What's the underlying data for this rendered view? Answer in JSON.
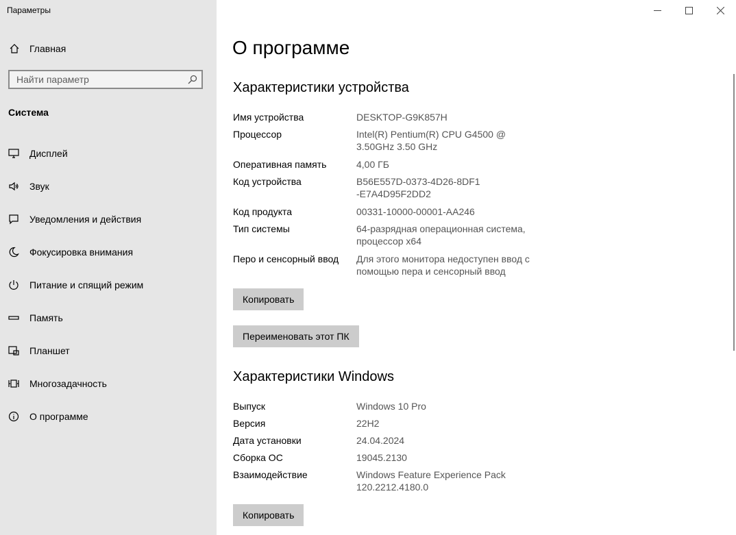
{
  "window": {
    "title": "Параметры"
  },
  "sidebar": {
    "home": "Главная",
    "search_placeholder": "Найти параметр",
    "section": "Система",
    "items": [
      {
        "label": "Дисплей",
        "icon": "monitor-icon"
      },
      {
        "label": "Звук",
        "icon": "speaker-icon"
      },
      {
        "label": "Уведомления и действия",
        "icon": "notification-icon"
      },
      {
        "label": "Фокусировка внимания",
        "icon": "moon-icon"
      },
      {
        "label": "Питание и спящий режим",
        "icon": "power-icon"
      },
      {
        "label": "Память",
        "icon": "storage-icon"
      },
      {
        "label": "Планшет",
        "icon": "tablet-icon"
      },
      {
        "label": "Многозадачность",
        "icon": "multitasking-icon"
      },
      {
        "label": "О программе",
        "icon": "info-icon"
      }
    ]
  },
  "main": {
    "title": "О программе",
    "device": {
      "heading": "Характеристики устройства",
      "rows": [
        {
          "key": "Имя устройства",
          "value": "DESKTOP-G9K857H"
        },
        {
          "key": "Процессор",
          "value": "Intel(R) Pentium(R) CPU G4500 @ 3.50GHz 3.50 GHz"
        },
        {
          "key": "Оперативная память",
          "value": "4,00 ГБ"
        },
        {
          "key": "Код устройства",
          "value": "B56E557D-0373-4D26-8DF1-E7A4D95F2DD2"
        },
        {
          "key": "Код продукта",
          "value": "00331-10000-00001-AA246"
        },
        {
          "key": "Тип системы",
          "value": "64-разрядная операционная система, процессор x64"
        },
        {
          "key": "Перо и сенсорный ввод",
          "value": "Для этого монитора недоступен ввод с помощью пера и сенсорный ввод"
        }
      ],
      "copy_button": "Копировать",
      "rename_button": "Переименовать этот ПК"
    },
    "windows": {
      "heading": "Характеристики Windows",
      "rows": [
        {
          "key": "Выпуск",
          "value": "Windows 10 Pro"
        },
        {
          "key": "Версия",
          "value": "22H2"
        },
        {
          "key": "Дата установки",
          "value": "24.04.2024"
        },
        {
          "key": "Сборка ОС",
          "value": "19045.2130"
        },
        {
          "key": "Взаимодействие",
          "value": "Windows Feature Experience Pack 120.2212.4180.0"
        }
      ],
      "copy_button": "Копировать"
    }
  }
}
